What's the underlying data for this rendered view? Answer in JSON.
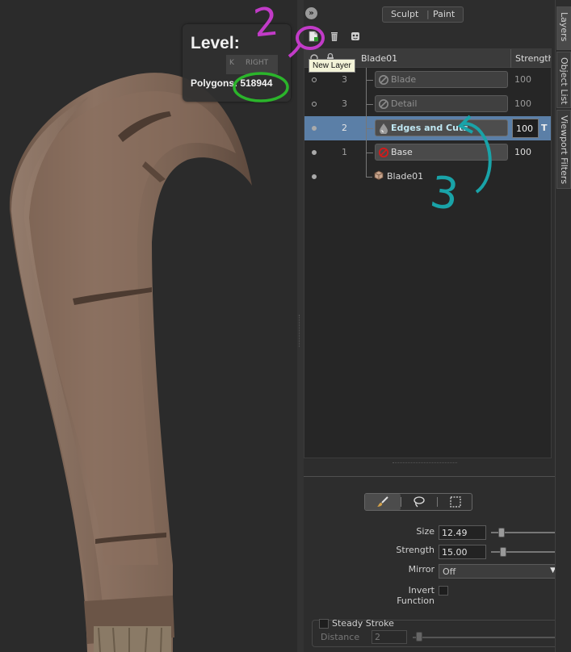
{
  "viewport": {
    "level_label": "Level:",
    "level_value": "",
    "cube_hint_key": "K",
    "cube_hint_face": "RIGHT",
    "polygons_label": "Polygons: 518944"
  },
  "panel": {
    "collapse_glyph": "»",
    "mode_sculpt": "Sculpt",
    "mode_paint": "Paint",
    "mode_sep": "|",
    "tooltip": "New Layer",
    "layers_header": {
      "name": "Blade01",
      "strength": "Strength"
    },
    "layers": [
      {
        "level": "3",
        "name": "Blade",
        "strength": "100",
        "visible": false,
        "selected": false
      },
      {
        "level": "3",
        "name": "Detail",
        "strength": "100",
        "visible": false,
        "selected": false
      },
      {
        "level": "2",
        "name": "Edges and Cuts",
        "strength": "100",
        "visible": true,
        "selected": true
      },
      {
        "level": "1",
        "name": "Base",
        "strength": "100",
        "visible": true,
        "selected": false
      }
    ],
    "mesh_name": "Blade01",
    "row_handle": "T"
  },
  "tool": {
    "size_label": "Size",
    "size_value": "12.49",
    "size_fraction": 0.11,
    "strength_label": "Strength",
    "strength_value": "15.00",
    "strength_fraction": 0.13,
    "mirror_label": "Mirror",
    "mirror_value": "Off",
    "invert_label": "Invert Function",
    "steady_label": "Steady Stroke",
    "distance_label": "Distance",
    "distance_value": "2"
  },
  "side_tabs": {
    "layers": "Layers",
    "object_list": "Object List",
    "viewport_filters": "Viewport Filters"
  },
  "annotations": {
    "num2": "2",
    "num3": "3"
  },
  "colors": {
    "selected_row": "#5b7fa7",
    "annotation_magenta": "#c23bc8",
    "annotation_green": "#2bb52b",
    "annotation_cyan": "#19a3a8",
    "blade": "#7e6554"
  }
}
